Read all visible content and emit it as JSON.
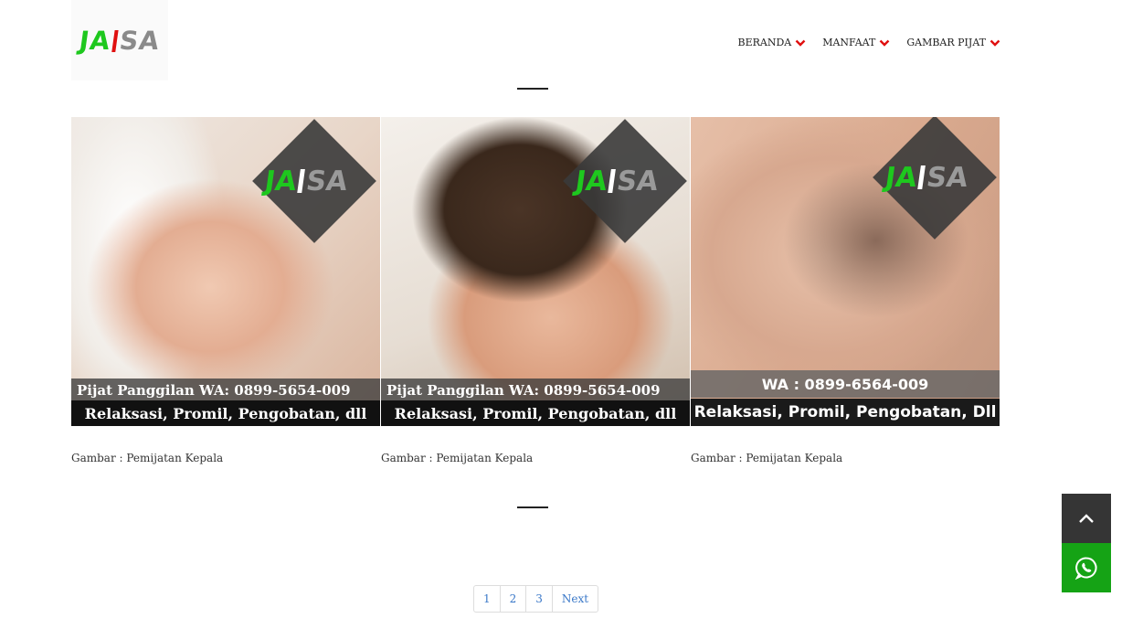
{
  "brand": {
    "logo_left": "JA",
    "logo_right": "SA"
  },
  "nav": {
    "items": [
      {
        "label": "BERANDA"
      },
      {
        "label": "MANFAAT"
      },
      {
        "label": "GAMBAR PIJAT"
      }
    ]
  },
  "gallery": {
    "items": [
      {
        "watermark_left": "JA",
        "watermark_right": "SA",
        "band_top": "Pijat Panggilan WA: 0899-5654-009",
        "band_bottom": "Relaksasi, Promil, Pengobatan, dll",
        "caption": "Gambar : Pemijatan Kepala"
      },
      {
        "watermark_left": "JA",
        "watermark_right": "SA",
        "band_top": "Pijat Panggilan WA: 0899-5654-009",
        "band_bottom": "Relaksasi, Promil, Pengobatan, dll",
        "caption": "Gambar : Pemijatan Kepala"
      },
      {
        "watermark_left": "JA",
        "watermark_right": "SA",
        "band_top": "WA : 0899-6564-009",
        "band_bottom": "Relaksasi, Promil, Pengobatan, Dll",
        "caption": "Gambar : Pemijatan Kepala"
      }
    ]
  },
  "pagination": {
    "pages": [
      "1",
      "2",
      "3"
    ],
    "next_label": "Next"
  },
  "colors": {
    "accent_red": "#e01010",
    "brand_green": "#1ec81e",
    "whatsapp_green": "#15a315",
    "scroll_top_bg": "#353535"
  },
  "icons": {
    "nav_chevron": "chevron-down-icon",
    "scroll_top": "chevron-up-icon",
    "whatsapp": "whatsapp-icon"
  }
}
